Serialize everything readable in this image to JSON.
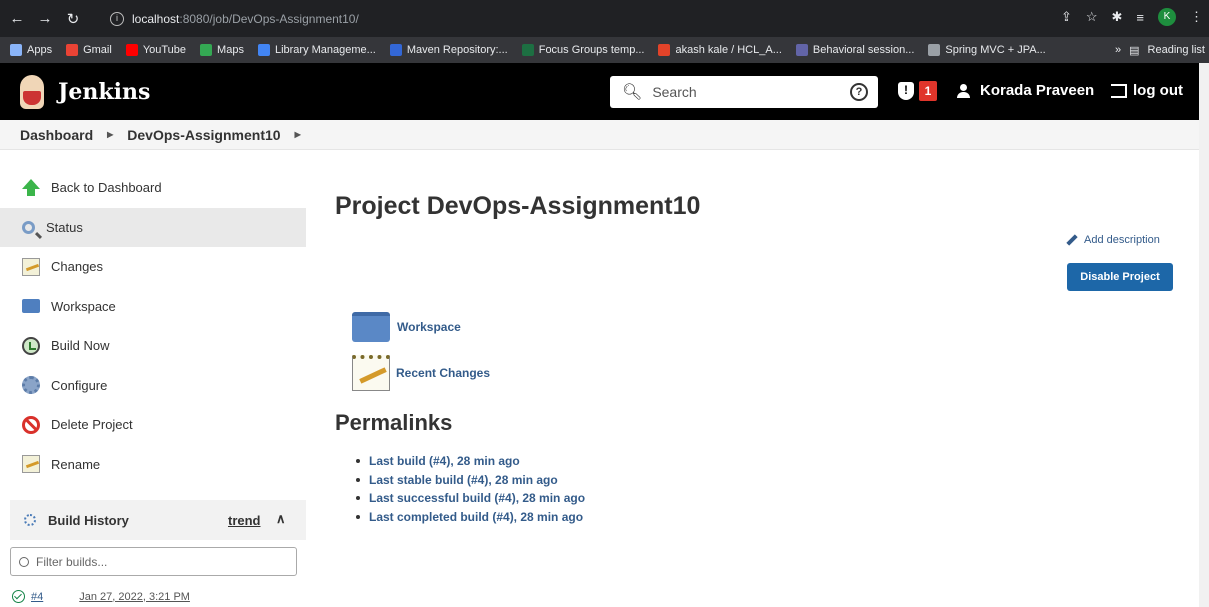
{
  "browser": {
    "url_host": "localhost",
    "url_path": ":8080/job/DevOps-Assignment10/",
    "profile_initial": "K",
    "bookmarks": [
      {
        "label": "Apps",
        "color": "#8ab4f8"
      },
      {
        "label": "Gmail",
        "color": "#ea4335"
      },
      {
        "label": "YouTube",
        "color": "#ff0000"
      },
      {
        "label": "Maps",
        "color": "#34a853"
      },
      {
        "label": "Library Manageme...",
        "color": "#4285f4"
      },
      {
        "label": "Maven Repository:...",
        "color": "#3367d6"
      },
      {
        "label": "Focus Groups temp...",
        "color": "#1d6f42"
      },
      {
        "label": "akash kale / HCL_A...",
        "color": "#e24329"
      },
      {
        "label": "Behavioral session...",
        "color": "#6264a7"
      },
      {
        "label": "Spring MVC + JPA...",
        "color": "#9aa0a6"
      }
    ],
    "overflow": "»",
    "reading_list": "Reading list"
  },
  "header": {
    "app_name": "Jenkins",
    "search_placeholder": "Search",
    "security_count": "1",
    "user_name": "Korada Praveen",
    "logout_label": "log out"
  },
  "breadcrumb": {
    "items": [
      "Dashboard",
      "DevOps-Assignment10"
    ]
  },
  "sidebar": {
    "items": [
      {
        "label": "Back to Dashboard",
        "icon": "up-arrow-icon"
      },
      {
        "label": "Status",
        "icon": "magnifier-icon"
      },
      {
        "label": "Changes",
        "icon": "notepad-icon"
      },
      {
        "label": "Workspace",
        "icon": "folder-icon"
      },
      {
        "label": "Build Now",
        "icon": "clock-icon"
      },
      {
        "label": "Configure",
        "icon": "gear-icon"
      },
      {
        "label": "Delete Project",
        "icon": "ban-icon"
      },
      {
        "label": "Rename",
        "icon": "notepad-icon"
      }
    ],
    "active_index": 1,
    "build_history": {
      "title": "Build History",
      "trend_label": "trend",
      "filter_placeholder": "Filter builds...",
      "builds": [
        {
          "number": "#4",
          "date": "Jan 27, 2022, 3:21 PM",
          "status": "success"
        }
      ]
    }
  },
  "main": {
    "title": "Project DevOps-Assignment10",
    "add_description_label": "Add description",
    "disable_button_label": "Disable Project",
    "links": [
      {
        "label": "Workspace",
        "icon": "folder-icon"
      },
      {
        "label": "Recent Changes",
        "icon": "notepad-icon"
      }
    ],
    "permalinks_title": "Permalinks",
    "permalinks": [
      "Last build (#4), 28 min ago",
      "Last stable build (#4), 28 min ago",
      "Last successful build (#4), 28 min ago",
      "Last completed build (#4), 28 min ago"
    ]
  },
  "colors": {
    "link": "#335b8a",
    "primary_button": "#1d67a8",
    "header_bg": "#000000",
    "badge": "#e0352b"
  }
}
